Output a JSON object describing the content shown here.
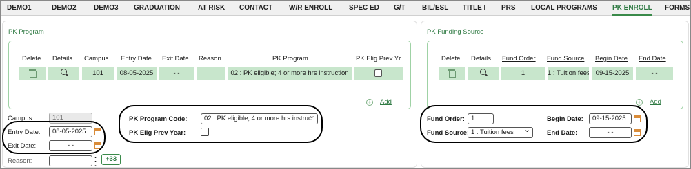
{
  "tabs": [
    {
      "label": "DEMO1"
    },
    {
      "label": "DEMO2"
    },
    {
      "label": "DEMO3"
    },
    {
      "label": "GRADUATION"
    },
    {
      "label": "AT RISK"
    },
    {
      "label": "CONTACT"
    },
    {
      "label": "W/R ENROLL"
    },
    {
      "label": "SPEC ED"
    },
    {
      "label": "G/T"
    },
    {
      "label": "BIL/ESL"
    },
    {
      "label": "TITLE I"
    },
    {
      "label": "PRS"
    },
    {
      "label": "LOCAL PROGRAMS"
    },
    {
      "label": "PK ENROLL"
    },
    {
      "label": "FORMS"
    }
  ],
  "active_tab": "PK ENROLL",
  "pk_program": {
    "title": "PK Program",
    "headers": {
      "delete": "Delete",
      "details": "Details",
      "campus": "Campus",
      "entry_date": "Entry Date",
      "exit_date": "Exit Date",
      "reason": "Reason",
      "pk_program": "PK Program",
      "pk_elig_prev_yr": "PK Elig Prev Yr"
    },
    "row": {
      "campus": "101",
      "entry_date": "08-05-2025",
      "exit_date": "- -",
      "reason": "",
      "pk_program": "02 : PK eligible; 4 or more hrs instruction",
      "pk_elig_prev_yr": false
    },
    "add_label": "Add",
    "form": {
      "campus_label": "Campus:",
      "campus_value": "101",
      "entry_date_label": "Entry Date:",
      "entry_date_value": "08-05-2025",
      "exit_date_label": "Exit Date:",
      "exit_date_value": "- -",
      "reason_label": "Reason:",
      "reason_value": "",
      "reason_more_badge": "+33",
      "program_code_label": "PK Program Code:",
      "program_code_value": "02 : PK eligible; 4 or more hrs instruc",
      "elig_prev_year_label": "PK Elig Prev Year:"
    }
  },
  "pk_funding": {
    "title": "PK Funding Source",
    "headers": {
      "delete": "Delete",
      "details": "Details",
      "fund_order": "Fund Order",
      "fund_source": "Fund Source",
      "begin_date": "Begin Date",
      "end_date": "End Date"
    },
    "row": {
      "fund_order": "1",
      "fund_source": "1 : Tuition fees",
      "begin_date": "09-15-2025",
      "end_date": "- -"
    },
    "add_label": "Add",
    "form": {
      "fund_order_label": "Fund Order:",
      "fund_order_value": "1",
      "fund_source_label": "Fund Source:",
      "fund_source_value": "1 : Tuition fees",
      "begin_date_label": "Begin Date:",
      "begin_date_value": "09-15-2025",
      "end_date_label": "End Date:",
      "end_date_value": "- -"
    }
  },
  "colors": {
    "accent": "#2f7a43",
    "row_fill": "#c8e6cc",
    "grid_border": "#9fd2a5",
    "highlight_oval": "#000000"
  }
}
